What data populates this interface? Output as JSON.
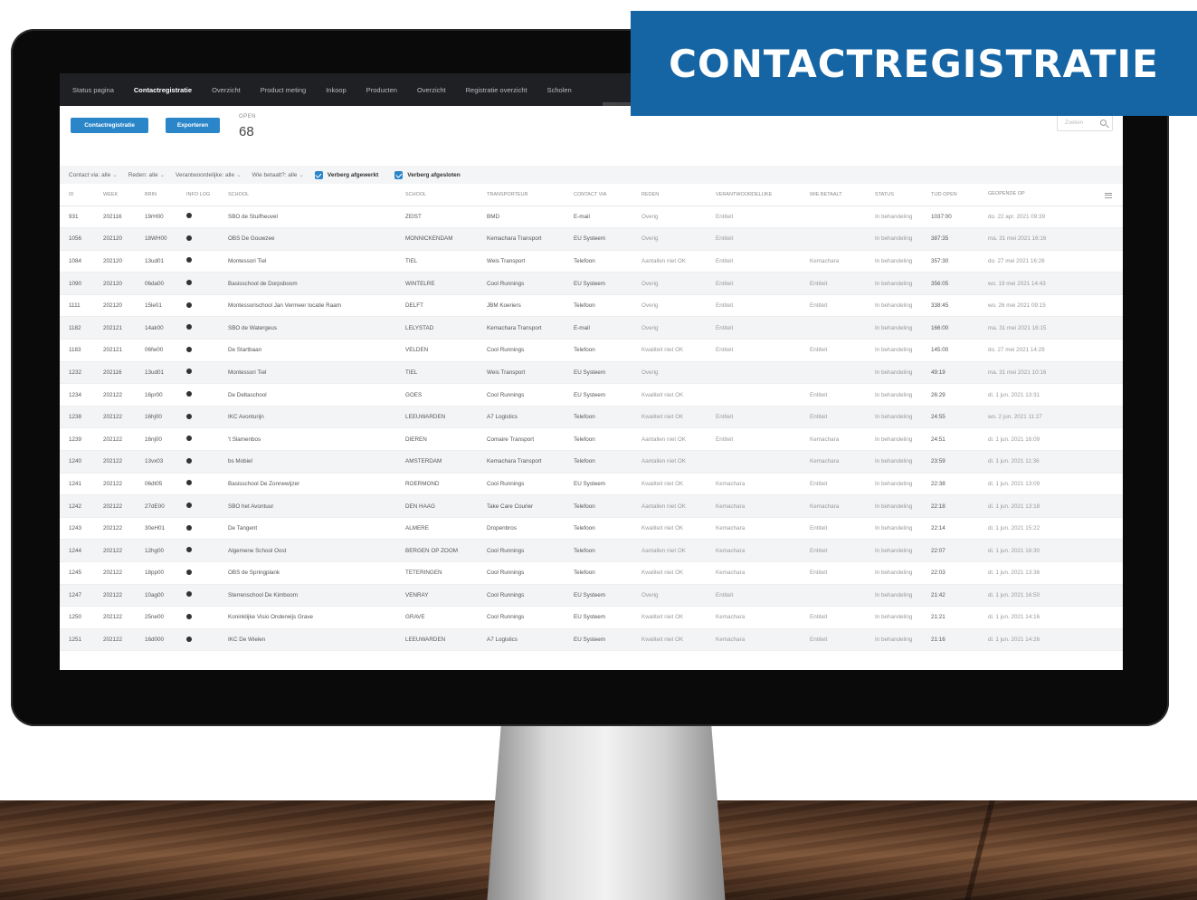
{
  "banner": {
    "title": "CONTACTREGISTRATIE"
  },
  "nav": {
    "items": [
      {
        "label": "Status pagina"
      },
      {
        "label": "Contactregistratie"
      },
      {
        "label": "Overzicht"
      },
      {
        "label": "Product meting"
      },
      {
        "label": "Inkoop"
      },
      {
        "label": "Producten"
      },
      {
        "label": "Overzicht"
      },
      {
        "label": "Registratie overzicht"
      },
      {
        "label": "Scholen"
      }
    ]
  },
  "toolbar": {
    "contact_button": "Contactregistratie",
    "export_button": "Exporteren",
    "open_label": "OPEN",
    "open_count": "68",
    "search_placeholder": "Zoeken"
  },
  "filters": {
    "contact_via": "Contact via: alle",
    "reden": "Reden: alle",
    "verantwoordelijke": "Verantwoordelijke: alle",
    "wie_betaalt": "Wie betaalt?: alle",
    "hide_done": "Verberg afgewerkt",
    "hide_closed": "Verberg afgesloten"
  },
  "table": {
    "headers": [
      "ID",
      "WEEK",
      "BRIN",
      "INFO LOG",
      "SCHOOL",
      "SCHOOL",
      "TRANSPORTEUR",
      "CONTACT VIA",
      "REDEN",
      "VERANTWOORDELIJKE",
      "WIE BETAALT",
      "STATUS",
      "TIJD OPEN",
      "GEOPENDE OP"
    ],
    "rows": [
      [
        "931",
        "202116",
        "19rH00",
        "",
        "SBO de Stuifheuvel",
        "ZEIST",
        "BMD",
        "E-mail",
        "Overig",
        "Entiteit",
        "",
        "In behandeling",
        "1037:00",
        "do. 22 apr. 2021 09:39"
      ],
      [
        "1056",
        "202120",
        "18WH00",
        "",
        "OBS De Gouwzee",
        "MONNICKENDAM",
        "Kemachara Transport",
        "EU Systeem",
        "Overig",
        "Entiteit",
        "",
        "In behandeling",
        "387:35",
        "ma. 31 mei 2021 16:16"
      ],
      [
        "1084",
        "202120",
        "13ud01",
        "",
        "Montessori Tiel",
        "TIEL",
        "Weis Transport",
        "Telefoon",
        "Aantallen niet OK",
        "Entiteit",
        "Kemachara",
        "In behandeling",
        "357:30",
        "do. 27 mei 2021 16:26"
      ],
      [
        "1090",
        "202120",
        "06da00",
        "",
        "Basisschool de Dorpsboom",
        "WINTELRE",
        "Cool Runnings",
        "EU Systeem",
        "Overig",
        "Entiteit",
        "Entiteit",
        "In behandeling",
        "356:05",
        "wo. 19 mei 2021 14:43"
      ],
      [
        "1111",
        "202120",
        "15le01",
        "",
        "Montessorischool Jan Vermeer locatie Raam",
        "DELFT",
        "JBM Koeriers",
        "Telefoon",
        "Overig",
        "Entiteit",
        "Entiteit",
        "In behandeling",
        "338:45",
        "wo. 26 mei 2021 09:15"
      ],
      [
        "1182",
        "202121",
        "14ak00",
        "",
        "SBO de Watergeus",
        "LELYSTAD",
        "Kemachara Transport",
        "E-mail",
        "Overig",
        "Entiteit",
        "",
        "In behandeling",
        "166:00",
        "ma. 31 mei 2021 16:15"
      ],
      [
        "1183",
        "202121",
        "06fw00",
        "",
        "De Startbaan",
        "VELDEN",
        "Cool Runnings",
        "Telefoon",
        "Kwaliteit niet OK",
        "Entiteit",
        "Entiteit",
        "In behandeling",
        "145:00",
        "do. 27 mei 2021 14:29"
      ],
      [
        "1232",
        "202116",
        "13ud01",
        "",
        "Montessori Tiel",
        "TIEL",
        "Weis Transport",
        "EU Systeem",
        "Overig",
        "",
        "",
        "In behandeling",
        "49:19",
        "ma. 31 mei 2021 10:16"
      ],
      [
        "1234",
        "202122",
        "16pr00",
        "",
        "De Deltaschool",
        "GOES",
        "Cool Runnings",
        "EU Systeem",
        "Kwaliteit niet OK",
        "",
        "Entiteit",
        "In behandeling",
        "26:29",
        "di. 1 jun. 2021 13:31"
      ],
      [
        "1238",
        "202122",
        "16hj00",
        "",
        "IKC Avonturijn",
        "LEEUWARDEN",
        "A7 Logistics",
        "Telefoon",
        "Kwaliteit niet OK",
        "Entiteit",
        "Entiteit",
        "In behandeling",
        "24:55",
        "wo. 2 jun. 2021 11:27"
      ],
      [
        "1239",
        "202122",
        "16nj00",
        "",
        "'t Slamenbos",
        "DIEREN",
        "Comaire Transport",
        "Telefoon",
        "Aantallen niet OK",
        "Entiteit",
        "Kemachara",
        "In behandeling",
        "24:51",
        "di. 1 jun. 2021 16:09"
      ],
      [
        "1240",
        "202122",
        "13vx03",
        "",
        "bs Mobiel",
        "AMSTERDAM",
        "Kemachara Transport",
        "Telefoon",
        "Aantallen niet OK",
        "",
        "Kemachara",
        "In behandeling",
        "23:59",
        "di. 1 jun. 2021 11:36"
      ],
      [
        "1241",
        "202122",
        "06dt05",
        "",
        "Basisschool De Zonnewijzer",
        "ROERMOND",
        "Cool Runnings",
        "EU Systeem",
        "Kwaliteit niet OK",
        "Kemachara",
        "Entiteit",
        "In behandeling",
        "22:38",
        "di. 1 jun. 2021 13:09"
      ],
      [
        "1242",
        "202122",
        "27dE00",
        "",
        "SBO het Avontuur",
        "DEN HAAG",
        "Take Care Courier",
        "Telefoon",
        "Aantallen niet OK",
        "Kemachara",
        "Kemachara",
        "In behandeling",
        "22:18",
        "di. 1 jun. 2021 13:18"
      ],
      [
        "1243",
        "202122",
        "30eH01",
        "",
        "De Tangent",
        "ALMERE",
        "Dropenbros",
        "Telefoon",
        "Kwaliteit niet OK",
        "Kemachara",
        "Entiteit",
        "In behandeling",
        "22:14",
        "di. 1 jun. 2021 15:22"
      ],
      [
        "1244",
        "202122",
        "12hg00",
        "",
        "Algemene School Oost",
        "BERGEN OP ZOOM",
        "Cool Runnings",
        "Telefoon",
        "Aantallen niet OK",
        "Kemachara",
        "Entiteit",
        "In behandeling",
        "22:07",
        "di. 1 jun. 2021 16:30"
      ],
      [
        "1245",
        "202122",
        "18pp00",
        "",
        "OBS de Springplank",
        "TETERINGEN",
        "Cool Runnings",
        "Telefoon",
        "Kwaliteit niet OK",
        "Kemachara",
        "Entiteit",
        "In behandeling",
        "22:03",
        "di. 1 jun. 2021 13:36"
      ],
      [
        "1247",
        "202122",
        "10ag00",
        "",
        "Sterrenschool De Kimboom",
        "VENRAY",
        "Cool Runnings",
        "EU Systeem",
        "Overig",
        "Entiteit",
        "",
        "In behandeling",
        "21:42",
        "di. 1 jun. 2021 16:50"
      ],
      [
        "1250",
        "202122",
        "25ne00",
        "",
        "Koninklijke Visio Onderwijs Grave",
        "GRAVE",
        "Cool Runnings",
        "EU Systeem",
        "Kwaliteit niet OK",
        "Kemachara",
        "Entiteit",
        "In behandeling",
        "21:21",
        "di. 1 jun. 2021 14:16"
      ],
      [
        "1251",
        "202122",
        "16d000",
        "",
        "IKC De Wielen",
        "LEEUWARDEN",
        "A7 Logistics",
        "EU Systeem",
        "Kwaliteit niet OK",
        "Kemachara",
        "Entiteit",
        "In behandeling",
        "21:16",
        "di. 1 jun. 2021 14:26"
      ]
    ]
  },
  "colors": {
    "accent": "#2b86c9",
    "banner": "#1565a5",
    "nav_bg": "#1f2023"
  }
}
